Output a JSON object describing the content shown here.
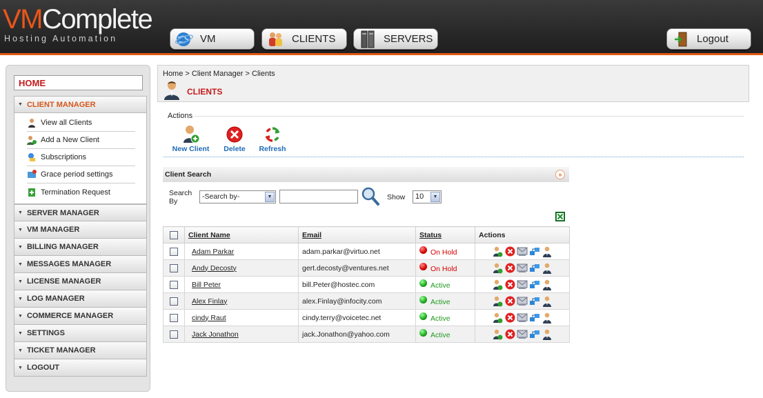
{
  "header": {
    "logo_brand_vm": "VM",
    "logo_brand_rest": "Complete",
    "logo_tagline": "Hosting Automation",
    "nav": [
      {
        "label": "VM",
        "icon": "globe-icon"
      },
      {
        "label": "CLIENTS",
        "icon": "users-icon"
      },
      {
        "label": "SERVERS",
        "icon": "server-icon"
      }
    ],
    "logout_label": "Logout"
  },
  "sidebar": {
    "home_label": "HOME",
    "active_section": {
      "label": "CLIENT MANAGER",
      "items": [
        {
          "label": "View all Clients",
          "icon": "user-icon"
        },
        {
          "label": "Add a New Client",
          "icon": "add-user-icon"
        },
        {
          "label": "Subscriptions",
          "icon": "subscriptions-icon"
        },
        {
          "label": "Grace period settings",
          "icon": "grace-period-icon"
        },
        {
          "label": "Termination Request",
          "icon": "termination-icon"
        }
      ]
    },
    "sections": [
      "SERVER MANAGER",
      "VM MANAGER",
      "BILLING MANAGER",
      "MESSAGES MANAGER",
      "LICENSE MANAGER",
      "LOG MANAGER",
      "COMMERCE MANAGER",
      "SETTINGS",
      "TICKET MANAGER",
      "LOGOUT"
    ]
  },
  "main": {
    "breadcrumb": "Home > Client Manager > Clients",
    "page_title": "CLIENTS",
    "actions_label": "Actions",
    "actions": [
      {
        "label": "New Client",
        "icon": "new-client-icon"
      },
      {
        "label": "Delete",
        "icon": "delete-icon"
      },
      {
        "label": "Refresh",
        "icon": "refresh-icon"
      }
    ],
    "search": {
      "title": "Client Search",
      "search_by_label": "Search By",
      "search_by_value": "-Search by-",
      "search_input_value": "",
      "show_label": "Show",
      "show_value": "10"
    },
    "table": {
      "columns": [
        "Client Name",
        "Email",
        "Status",
        "Actions"
      ],
      "rows": [
        {
          "name": "Adam Parkar",
          "email": "adam.parkar@virtuo.net",
          "status": "On Hold",
          "status_color": "red"
        },
        {
          "name": "Andy Decosty",
          "email": "gert.decosty@ventures.net",
          "status": "On Hold",
          "status_color": "red"
        },
        {
          "name": "Bill Peter",
          "email": "bill.Peter@hostec.com",
          "status": "Active",
          "status_color": "green"
        },
        {
          "name": "Alex Finlay",
          "email": "alex.Finlay@infocity.com",
          "status": "Active",
          "status_color": "green"
        },
        {
          "name": "cindy Raut",
          "email": "cindy.terry@voicetec.net",
          "status": "Active",
          "status_color": "green"
        },
        {
          "name": "Jack Jonathon",
          "email": "jack.Jonathon@yahoo.com",
          "status": "Active",
          "status_color": "green"
        }
      ],
      "row_action_icons": [
        "edit-user-icon",
        "delete-icon",
        "mail-icon",
        "network-icon",
        "user-icon"
      ]
    }
  },
  "colors": {
    "accent": "#e05a12",
    "title_red": "#c41a1a",
    "link_blue": "#1f6bb5",
    "status_red": "#d40000",
    "status_green": "#1f9a1f"
  }
}
